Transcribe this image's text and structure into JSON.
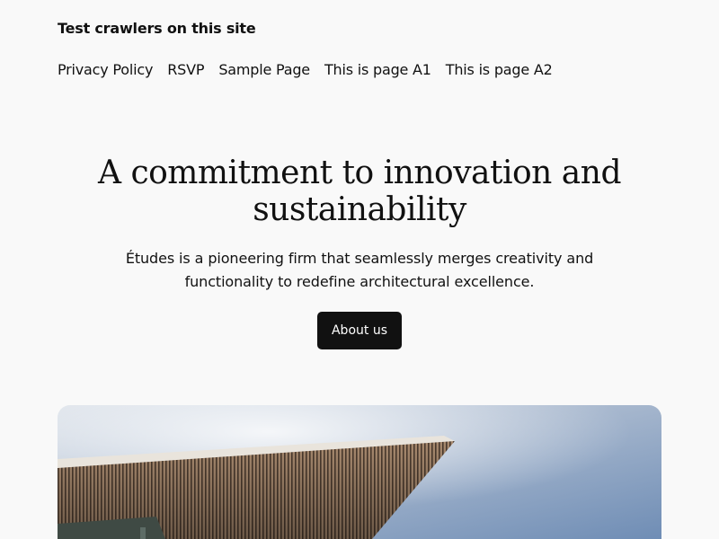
{
  "site": {
    "title": "Test crawlers on this site"
  },
  "nav": {
    "items": [
      {
        "label": "Privacy Policy"
      },
      {
        "label": "RSVP"
      },
      {
        "label": "Sample Page"
      },
      {
        "label": "This is page A1"
      },
      {
        "label": "This is page A2"
      }
    ]
  },
  "hero": {
    "heading": "A commitment to innovation and sustainability",
    "description": "Études is a pioneering firm that seamlessly merges creativity and functionality to redefine architectural excellence.",
    "button_label": "About us",
    "image_icon": "architecture-photo"
  },
  "colors": {
    "background": "#f9f9f9",
    "text": "#111111",
    "button_bg": "#111111",
    "button_text": "#ffffff",
    "sky": "#8fa6c4"
  }
}
